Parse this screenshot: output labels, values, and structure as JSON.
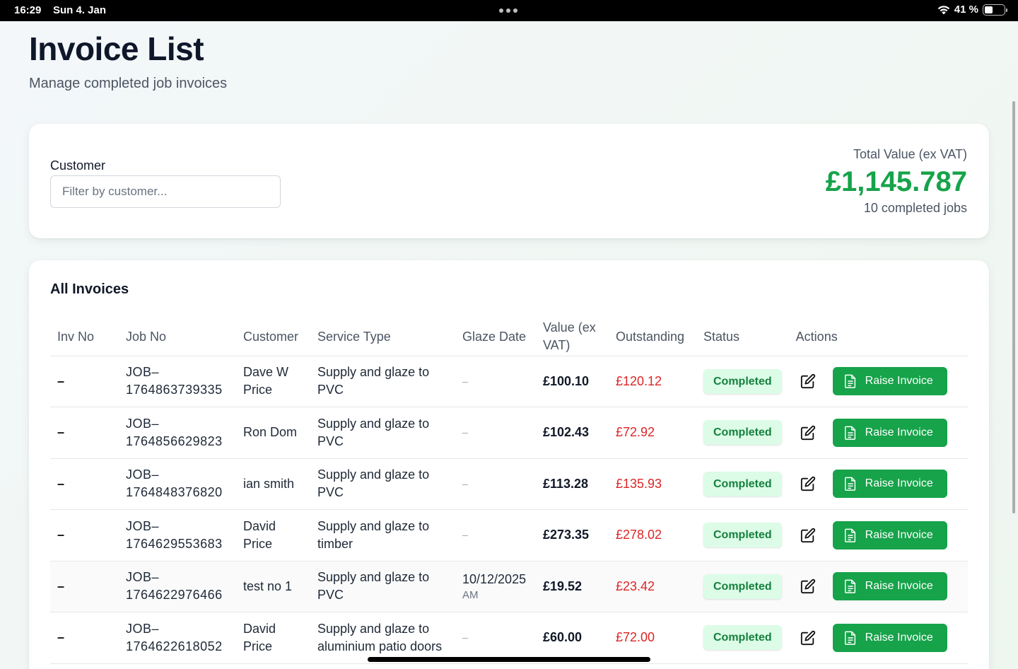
{
  "status_bar": {
    "time": "16:29",
    "date": "Sun 4. Jan",
    "battery": "41 %",
    "battery_level": 0.41
  },
  "header": {
    "title": "Invoice List",
    "subtitle": "Manage completed job invoices"
  },
  "filter": {
    "customer_label": "Customer",
    "customer_placeholder": "Filter by customer...",
    "customer_value": ""
  },
  "summary": {
    "total_label": "Total Value (ex VAT)",
    "total_value": "£1,145.787",
    "completed_count": "10 completed jobs"
  },
  "invoices": {
    "title": "All Invoices",
    "columns": [
      "Inv No",
      "Job No",
      "Customer",
      "Service Type",
      "Glaze Date",
      "Value (ex VAT)",
      "Outstanding",
      "Status",
      "Actions"
    ],
    "raise_label": "Raise Invoice",
    "rows": [
      {
        "inv_no": "–",
        "job_no": "JOB–1764863739335",
        "customer": "Dave W Price",
        "service": "Supply and glaze to PVC",
        "glaze_date": "–",
        "glaze_time": "",
        "value": "£100.10",
        "outstanding": "£120.12",
        "status": "Completed"
      },
      {
        "inv_no": "–",
        "job_no": "JOB–1764856629823",
        "customer": "Ron Dom",
        "service": "Supply and glaze to PVC",
        "glaze_date": "–",
        "glaze_time": "",
        "value": "£102.43",
        "outstanding": "£72.92",
        "status": "Completed"
      },
      {
        "inv_no": "–",
        "job_no": "JOB–1764848376820",
        "customer": "ian smith",
        "service": "Supply and glaze to PVC",
        "glaze_date": "–",
        "glaze_time": "",
        "value": "£113.28",
        "outstanding": "£135.93",
        "status": "Completed"
      },
      {
        "inv_no": "–",
        "job_no": "JOB–1764629553683",
        "customer": "David Price",
        "service": "Supply and glaze to timber",
        "glaze_date": "–",
        "glaze_time": "",
        "value": "£273.35",
        "outstanding": "£278.02",
        "status": "Completed"
      },
      {
        "inv_no": "–",
        "job_no": "JOB–1764622976466",
        "customer": "test no 1",
        "service": "Supply and glaze to PVC",
        "glaze_date": "10/12/2025",
        "glaze_time": "AM",
        "value": "£19.52",
        "outstanding": "£23.42",
        "status": "Completed"
      },
      {
        "inv_no": "–",
        "job_no": "JOB–1764622618052",
        "customer": "David Price",
        "service": "Supply and glaze to aluminium patio doors",
        "glaze_date": "–",
        "glaze_time": "",
        "value": "£60.00",
        "outstanding": "£72.00",
        "status": "Completed"
      }
    ]
  },
  "colors": {
    "accent_green": "#16a34a",
    "outstanding_red": "#dc2626",
    "badge_bg": "#dcfce7"
  },
  "icons": {
    "edit": "edit-icon",
    "document": "document-icon",
    "wifi": "wifi-icon",
    "battery": "battery-icon"
  }
}
